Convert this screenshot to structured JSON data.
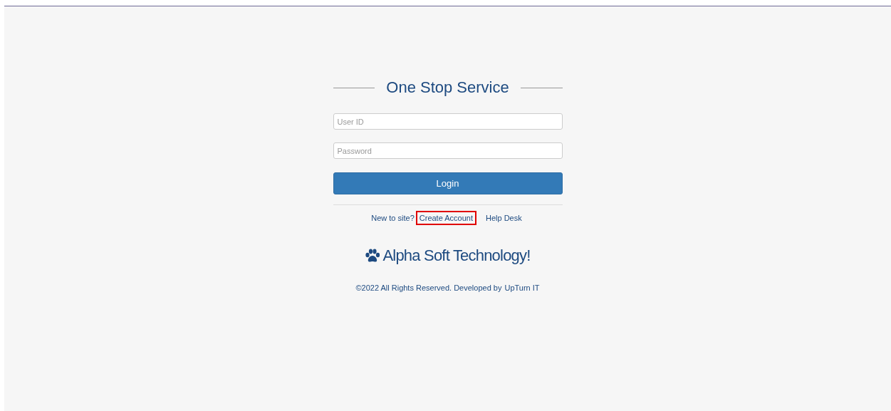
{
  "title": "One Stop Service",
  "fields": [
    {
      "placeholder": "User ID"
    },
    {
      "placeholder": "Password"
    }
  ],
  "login_button": "Login",
  "links": [
    {
      "text": "New to site?",
      "kind": "text",
      "highlighted": false
    },
    {
      "text": "Create Account",
      "kind": "link",
      "highlighted": true
    },
    {
      "text": "Help Desk",
      "kind": "link",
      "highlighted": false
    }
  ],
  "brand": "Alpha Soft Technology!",
  "footer": {
    "text": "©2022 All Rights Reserved. Developed by",
    "link": "UpTurn IT"
  }
}
